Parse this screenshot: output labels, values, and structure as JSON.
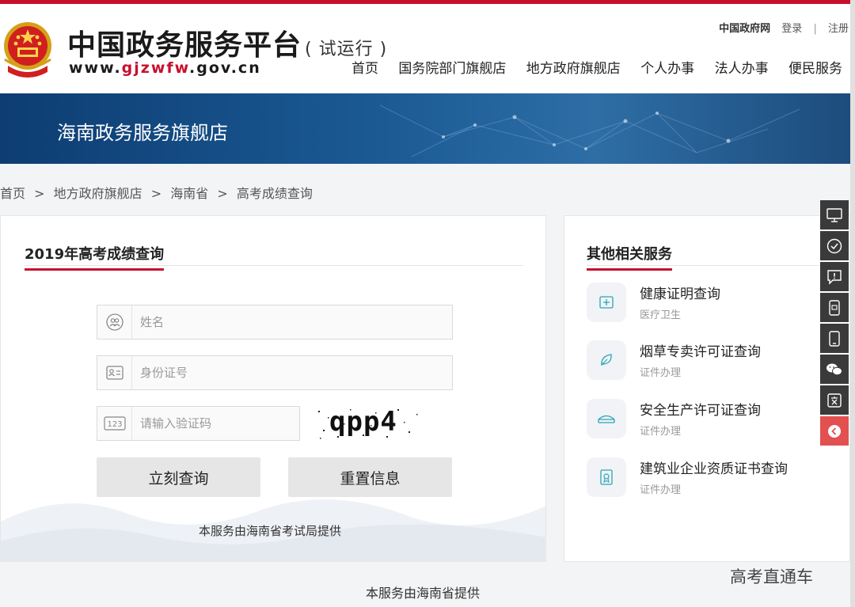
{
  "header": {
    "title": "中国政务服务平台",
    "trial": "( 试运行 )",
    "url_prefix": "www.",
    "url_red": "gjzwfw",
    "url_suffix": ".gov.cn",
    "top_links": [
      "中国政府网",
      "登录",
      "|",
      "注册"
    ],
    "nav": [
      "首页",
      "国务院部门旗舰店",
      "地方政府旗舰店",
      "个人办事",
      "法人办事",
      "便民服务"
    ]
  },
  "banner": {
    "title": "海南政务服务旗舰店"
  },
  "breadcrumb": [
    "首页",
    ">",
    "地方政府旗舰店",
    ">",
    "海南省",
    ">",
    "高考成绩查询"
  ],
  "form": {
    "title": "2019年高考成绩查询",
    "name_placeholder": "姓名",
    "id_placeholder": "身份证号",
    "captcha_placeholder": "请输入验证码",
    "captcha_text": "qpp4",
    "submit_label": "立刻查询",
    "reset_label": "重置信息",
    "provider": "本服务由海南省考试局提供"
  },
  "related": {
    "title": "其他相关服务",
    "items": [
      {
        "name": "健康证明查询",
        "category": "医疗卫生",
        "icon": "health-cert-icon"
      },
      {
        "name": "烟草专卖许可证查询",
        "category": "证件办理",
        "icon": "leaf-icon"
      },
      {
        "name": "安全生产许可证查询",
        "category": "证件办理",
        "icon": "safety-icon"
      },
      {
        "name": "建筑业企业资质证书查询",
        "category": "证件办理",
        "icon": "certificate-icon"
      }
    ]
  },
  "sidetools": [
    "monitor-icon",
    "check-icon",
    "feedback-icon",
    "mobile-app-icon",
    "phone-icon",
    "wechat-icon",
    "weibo-icon",
    "back-icon"
  ],
  "footer": {
    "note": "本服务由海南省提供"
  },
  "watermark": "高考直通车",
  "colors": {
    "brand_red": "#c8102e",
    "banner_blue": "#1b5a94",
    "side_dark": "#3a3a3a",
    "side_red": "#e25050"
  }
}
